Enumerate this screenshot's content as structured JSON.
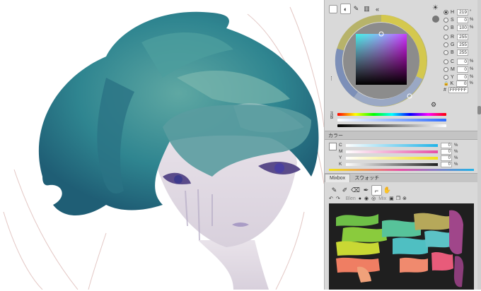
{
  "color_panel": {
    "fields": [
      {
        "label": "H",
        "value": "219",
        "unit": "°",
        "selected": true
      },
      {
        "label": "S",
        "value": "0",
        "unit": "%",
        "selected": false
      },
      {
        "label": "B",
        "value": "100",
        "unit": "%",
        "selected": false
      },
      {
        "label": "R",
        "value": "255",
        "unit": "",
        "selected": false
      },
      {
        "label": "G",
        "value": "255",
        "unit": "",
        "selected": false
      },
      {
        "label": "B",
        "value": "255",
        "unit": "",
        "selected": false
      },
      {
        "label": "C",
        "value": "0",
        "unit": "%",
        "selected": false
      },
      {
        "label": "M",
        "value": "0",
        "unit": "%",
        "selected": false
      },
      {
        "label": "Y",
        "value": "0",
        "unit": "%",
        "selected": false
      },
      {
        "label": "K",
        "value": "0",
        "unit": "%",
        "selected": false
      }
    ],
    "hex": "FFFFFF",
    "hex_prefix": "#",
    "side_label": "HSB"
  },
  "cmyk_section": {
    "title": "カラー",
    "rows": [
      {
        "label": "C",
        "value": "0",
        "unit": "%",
        "color": "#1fb3e8"
      },
      {
        "label": "M",
        "value": "0",
        "unit": "%",
        "color": "#e64fa6"
      },
      {
        "label": "Y",
        "value": "0",
        "unit": "%",
        "color": "#f2e21a"
      },
      {
        "label": "K",
        "value": "0",
        "unit": "%",
        "color": "#222222"
      }
    ]
  },
  "mixer_section": {
    "tabs": [
      "Mixbox",
      "スウォッチ"
    ],
    "active_tab": 0,
    "tools": [
      "brush-icon",
      "fill-brush-icon",
      "eraser-icon",
      "pen-icon",
      "eyedropper-icon",
      "hand-icon"
    ],
    "blend_label": "Blen",
    "mix_label": "Mix"
  },
  "colors": {
    "panel_bg": "#d9d9d9",
    "mixer_bg": "#1f1f1f",
    "current_color": "#ffffff"
  }
}
